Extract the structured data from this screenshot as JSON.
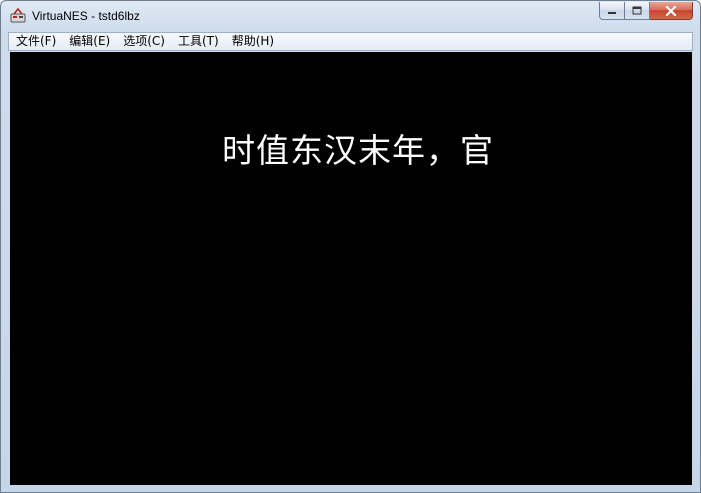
{
  "window": {
    "title": "VirtuaNES - tstd6lbz",
    "icon": "virtuanes-app-icon"
  },
  "caption_buttons": {
    "minimize_icon": "minimize-icon",
    "maximize_icon": "maximize-icon",
    "close_icon": "close-icon"
  },
  "menu": {
    "items": [
      {
        "label": "文件(F)"
      },
      {
        "label": "编辑(E)"
      },
      {
        "label": "选项(C)"
      },
      {
        "label": "工具(T)"
      },
      {
        "label": "帮助(H)"
      }
    ]
  },
  "game": {
    "text": "时值东汉末年，官"
  },
  "colors": {
    "screen_bg": "#000000",
    "game_text": "#ffffff",
    "close_button": "#c6452c",
    "frame": "#c6d5e8"
  }
}
